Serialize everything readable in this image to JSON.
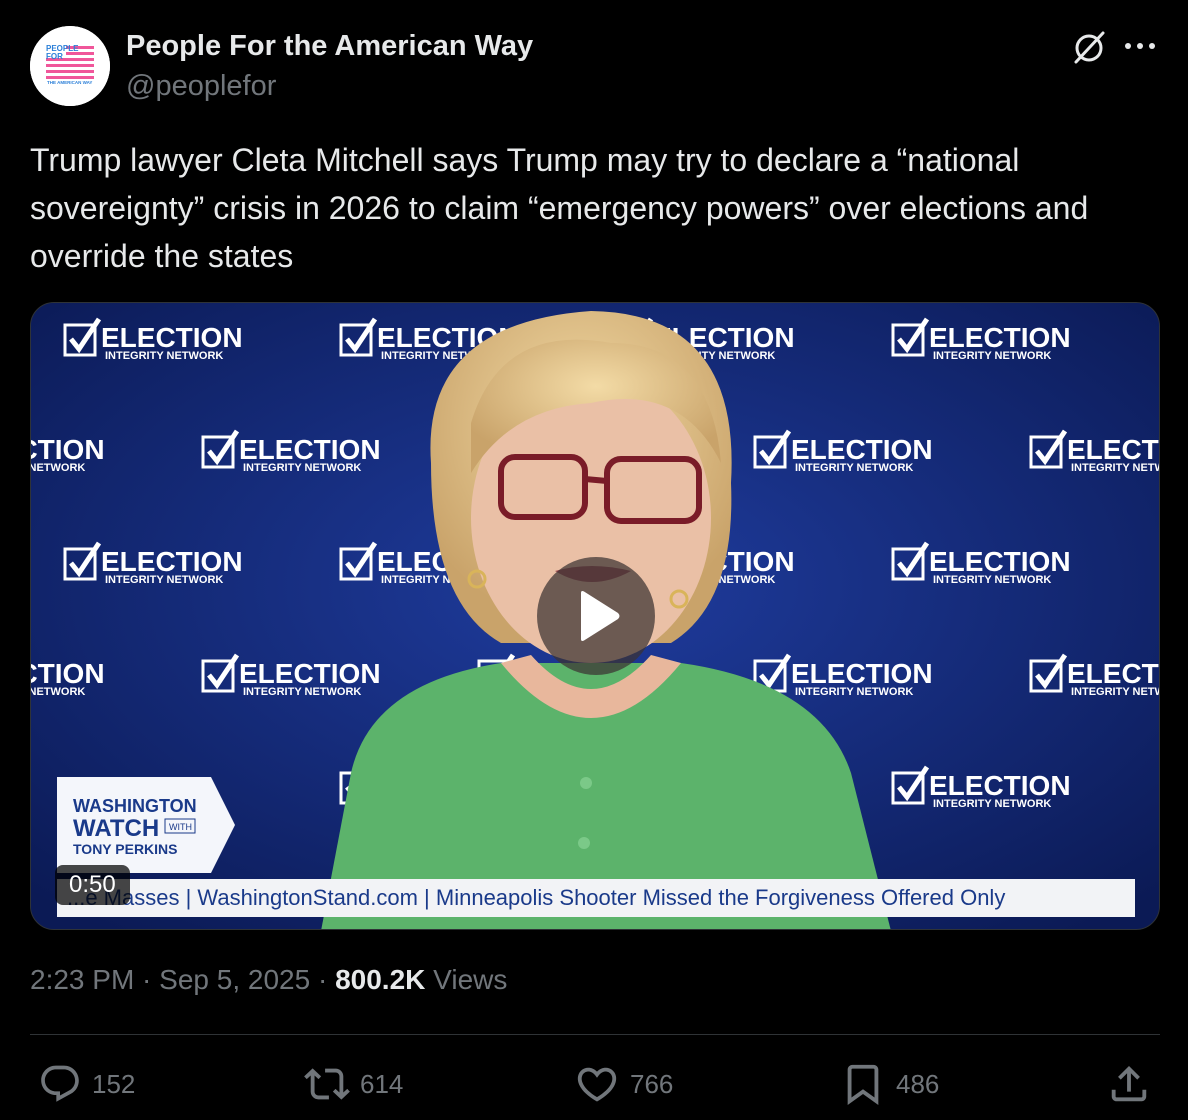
{
  "author": {
    "display_name": "People For the American Way",
    "handle": "@peoplefor",
    "avatar_logo_text": [
      "PEOPLE",
      "FOR",
      "THE AMERICAN WAY"
    ]
  },
  "tweet": {
    "text": "Trump lawyer Cleta Mitchell says Trump may try to declare a “national sovereignty” crisis in 2026 to claim “emergency powers” over elections and override the states"
  },
  "video": {
    "duration": "0:50",
    "backdrop_logo": [
      "ELECTION",
      "INTEGRITY NETWORK"
    ],
    "lower_third": {
      "show_title_1": "WASHINGTON",
      "show_title_2": "WATCH",
      "with_label": "WITH",
      "host": "TONY PERKINS"
    },
    "ticker_text": "...e Masses   | WashingtonStand.com |   Minneapolis Shooter Missed the Forgiveness Offered Only"
  },
  "meta": {
    "time": "2:23 PM",
    "date": "Sep 5, 2025",
    "separator": " · ",
    "views_count": "800.2K",
    "views_label": "Views"
  },
  "actions": {
    "replies": "152",
    "reposts": "614",
    "likes": "766",
    "bookmarks": "486"
  },
  "icons": [
    "grok-icon",
    "more-icon",
    "play-icon",
    "reply-icon",
    "repost-icon",
    "like-icon",
    "bookmark-icon",
    "share-icon"
  ],
  "colors": {
    "background": "#000000",
    "text_primary": "#e7e9ea",
    "text_secondary": "#71767b",
    "divider": "#2f3336",
    "backdrop_blue": "#13287a",
    "sweater_green": "#5cb36b",
    "ticker_blue": "#1a3a8a"
  }
}
